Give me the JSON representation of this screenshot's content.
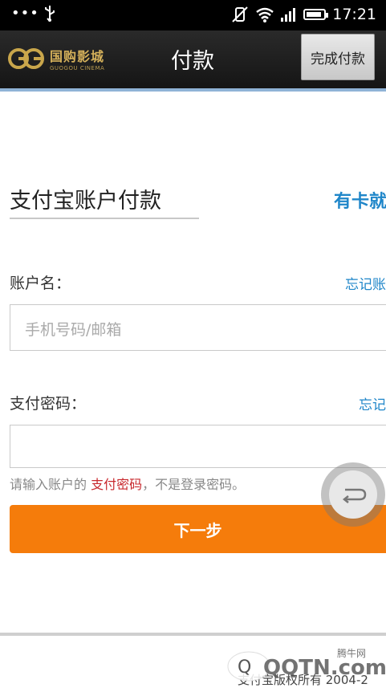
{
  "status_bar": {
    "dots": "•••",
    "time": "17:21",
    "icons": [
      "usb-icon",
      "mute-icon",
      "wifi-icon",
      "signal-icon",
      "battery-icon"
    ],
    "battery_level": 0.9
  },
  "header": {
    "logo_cn": "国购影城",
    "logo_en": "GUOGOU CINEMA",
    "title": "付款",
    "done_label": "完成付款"
  },
  "main": {
    "section_title": "支付宝账户付款",
    "card_link": "有卡就",
    "account": {
      "label": "账户名：",
      "forgot": "忘记账",
      "placeholder": "手机号码/邮箱"
    },
    "password": {
      "label": "支付密码：",
      "forgot": "忘记",
      "value": ""
    },
    "hint": {
      "prefix": "请输入账户的",
      "emphasis": "支付密码",
      "suffix": "，不是登录密码。"
    },
    "next_label": "下一步"
  },
  "footer": {
    "copyright": "支付宝版权所有 2004-2",
    "watermark_label": "腾牛网",
    "watermark_text": "QQTN.com"
  },
  "colors": {
    "accent": "#1f86c9",
    "button": "#f57c0b",
    "emphasis": "#c8282d",
    "header_bg": "#1c1c1c"
  }
}
